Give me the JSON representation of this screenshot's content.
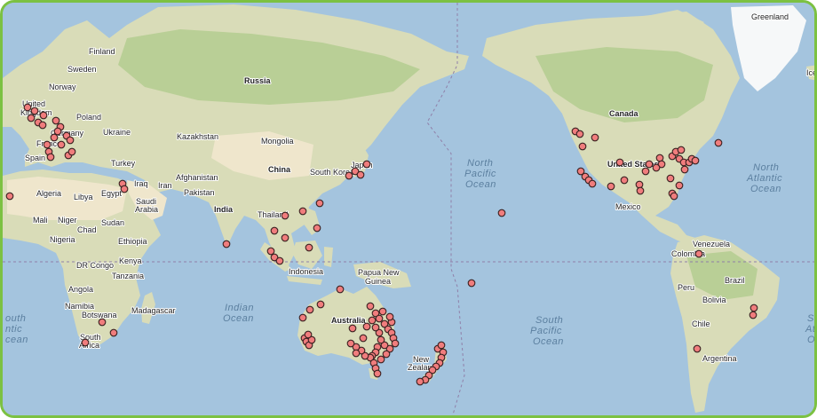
{
  "map": {
    "colors": {
      "frame": "#7cc142",
      "ocean": "#a4c4de",
      "land": "#d9dcb8",
      "forest": "#b9cf96",
      "desert": "#efe6cc",
      "ice": "#f6f8f9",
      "boundary": "#8f7fa8",
      "marker_fill": "#f07d7d",
      "marker_stroke": "#3a2020"
    },
    "labels": {
      "greenland": "Greenland",
      "iceland": "Icel",
      "finland": "Finland",
      "sweden": "Sweden",
      "norway": "Norway",
      "russia": "Russia",
      "united_kingdom_1": "United",
      "united_kingdom_2": "Kingdom",
      "poland": "Poland",
      "germany": "Germany",
      "ukraine": "Ukraine",
      "france": "France",
      "spain": "Spain",
      "kazakhstan": "Kazakhstan",
      "mongolia": "Mongolia",
      "china": "China",
      "japan": "Japan",
      "south_korea": "South Korea",
      "turkey": "Turkey",
      "iraq": "Iraq",
      "iran": "Iran",
      "afghanistan": "Afghanistan",
      "pakistan": "Pakistan",
      "india": "India",
      "thailand": "Thailand",
      "algeria": "Algeria",
      "libya": "Libya",
      "egypt": "Egypt",
      "saudi_arabia_1": "Saudi",
      "saudi_arabia_2": "Arabia",
      "mali": "Mali",
      "niger": "Niger",
      "sudan": "Sudan",
      "chad": "Chad",
      "nigeria": "Nigeria",
      "ethiopia": "Ethiopia",
      "kenya": "Kenya",
      "dr_congo": "DR Congo",
      "tanzania": "Tanzania",
      "angola": "Angola",
      "namibia": "Namibia",
      "botswana": "Botswana",
      "madagascar": "Madagascar",
      "south_africa_1": "South",
      "south_africa_2": "Africa",
      "indonesia": "Indonesia",
      "png_1": "Papua New",
      "png_2": "Guinea",
      "australia": "Australia",
      "new_zealand_1": "New",
      "new_zealand_2": "Zealand",
      "canada": "Canada",
      "united_states": "United States",
      "mexico": "Mexico",
      "venezuela": "Venezuela",
      "colombia": "Colombia",
      "peru": "Peru",
      "brazil": "Brazil",
      "bolivia": "Bolivia",
      "chile": "Chile",
      "argentina": "Argentina"
    },
    "oceans": {
      "north_pacific_1": "North",
      "north_pacific_2": "Pacific",
      "north_pacific_3": "Ocean",
      "north_atlantic_1": "North",
      "north_atlantic_2": "Atlantic",
      "north_atlantic_3": "Ocean",
      "indian_1": "Indian",
      "indian_2": "Ocean",
      "south_pacific_1": "South",
      "south_pacific_2": "Pacific",
      "south_pacific_3": "Ocean",
      "south_atlantic_left_1": "outh",
      "south_atlantic_left_2": "ntic",
      "south_atlantic_left_3": "cean",
      "south_atlantic_right_1": "S",
      "south_atlantic_right_2": "At",
      "south_atlantic_right_3": "O"
    }
  }
}
